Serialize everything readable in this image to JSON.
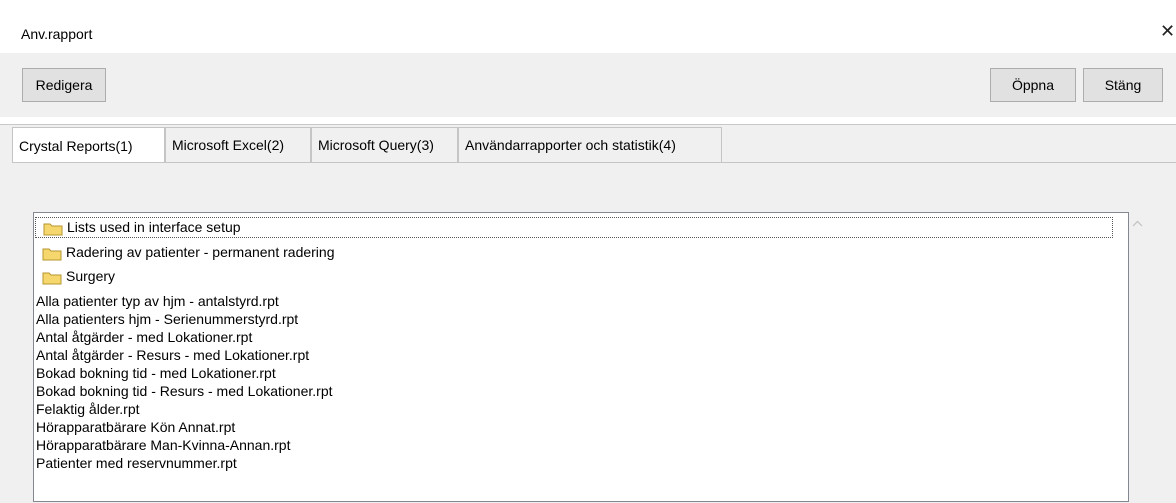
{
  "window": {
    "title": "Anv.rapport",
    "close_glyph": "✕"
  },
  "toolbar": {
    "edit_label": "Redigera",
    "open_label": "Öppna",
    "close_label": "Stäng"
  },
  "tabs": [
    {
      "label": "Crystal Reports(1)",
      "active": true
    },
    {
      "label": "Microsoft Excel(2)",
      "active": false
    },
    {
      "label": "Microsoft Query(3)",
      "active": false
    },
    {
      "label": "Användarrapporter och statistik(4)",
      "active": false
    }
  ],
  "list": {
    "folders": [
      {
        "label": "Lists used in interface setup",
        "icon": "folder-icon",
        "selected": true
      },
      {
        "label": "Radering av patienter - permanent radering",
        "icon": "folder-icon",
        "selected": false
      },
      {
        "label": "Surgery",
        "icon": "folder-icon",
        "selected": false
      }
    ],
    "files": [
      "Alla patienter typ av hjm - antalstyrd.rpt",
      "Alla patienters hjm - Serienummerstyrd.rpt",
      "Antal åtgärder - med Lokationer.rpt",
      "Antal åtgärder - Resurs - med Lokationer.rpt",
      "Bokad bokning tid - med Lokationer.rpt",
      "Bokad bokning tid - Resurs - med Lokationer.rpt",
      "Felaktig ålder.rpt",
      "Hörapparatbärare Kön Annat.rpt",
      "Hörapparatbärare Man-Kvinna-Annan.rpt",
      "Patienter med reservnummer.rpt"
    ]
  },
  "colors": {
    "folder_fill": "#f5d76e",
    "folder_stroke": "#b8962e"
  }
}
